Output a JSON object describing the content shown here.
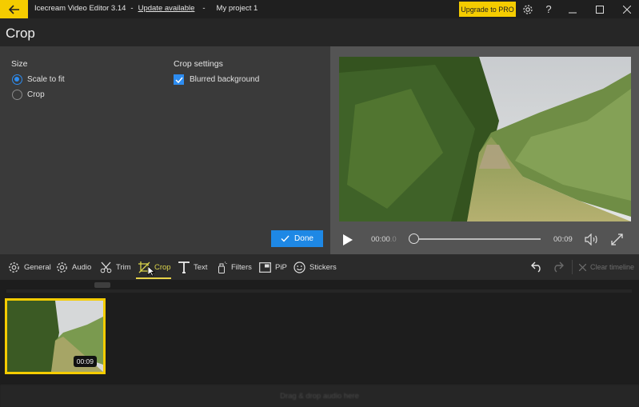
{
  "titlebar": {
    "app_name": "Icecream Video Editor 3.14",
    "separator": "-",
    "update_link": "Update available",
    "project_name": "My project 1",
    "upgrade_label": "Upgrade to PRO",
    "help_label": "?",
    "icons": [
      "back-arrow-icon",
      "gear-icon",
      "help-icon",
      "minimize-icon",
      "maximize-icon",
      "close-icon"
    ]
  },
  "page": {
    "title": "Crop"
  },
  "settings": {
    "size_label": "Size",
    "size_options": [
      {
        "label": "Scale to fit",
        "selected": true
      },
      {
        "label": "Crop",
        "selected": false
      }
    ],
    "crop_settings_label": "Crop settings",
    "blurred_background": {
      "label": "Blurred background",
      "checked": true
    },
    "done_label": "Done"
  },
  "player": {
    "current_time": "00:00",
    "current_time_fraction": ".0",
    "duration": "00:09",
    "progress": 0
  },
  "toolbar": {
    "tools": [
      {
        "label": "General",
        "icon": "gear-icon"
      },
      {
        "label": "Audio",
        "icon": "gear-icon"
      },
      {
        "label": "Trim",
        "icon": "scissors-icon"
      },
      {
        "label": "Crop",
        "icon": "crop-icon",
        "active": true
      },
      {
        "label": "Text",
        "icon": "text-icon"
      },
      {
        "label": "Filters",
        "icon": "spray-bottle-icon"
      },
      {
        "label": "PiP",
        "icon": "pip-icon"
      },
      {
        "label": "Stickers",
        "icon": "smiley-icon"
      }
    ],
    "clear_timeline_label": "Clear timeline"
  },
  "timeline": {
    "clips": [
      {
        "duration": "00:09",
        "selected": true
      }
    ],
    "audio_drop_label": "Drag & drop audio here"
  },
  "colors": {
    "accent_yellow": "#f5cc00",
    "accent_blue": "#1e88e5",
    "active_tool": "#d9d24a"
  }
}
